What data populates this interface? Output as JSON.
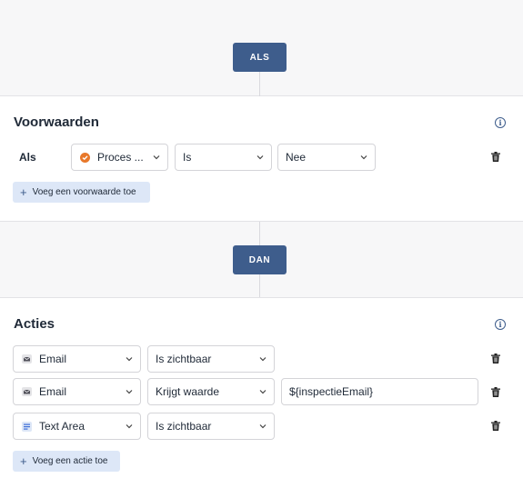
{
  "als_badge": "ALS",
  "dan_badge": "DAN",
  "conditions": {
    "title": "Voorwaarden",
    "row_label": "Als",
    "field": "Proces ...",
    "operator": "Is",
    "value": "Nee",
    "add_label": "Voeg een voorwaarde toe"
  },
  "actions": {
    "title": "Acties",
    "rows": [
      {
        "field": "Email",
        "field_icon": "email-icon",
        "action": "Is zichtbaar",
        "value": ""
      },
      {
        "field": "Email",
        "field_icon": "email-icon",
        "action": "Krijgt waarde",
        "value": "${inspectieEmail}"
      },
      {
        "field": "Text Area",
        "field_icon": "text-area-icon",
        "action": "Is zichtbaar",
        "value": ""
      }
    ],
    "add_label": "Voeg een actie toe"
  },
  "colors": {
    "accent": "#3e5d8c",
    "button_bg": "#dde7f7",
    "status_orange": "#e8782a"
  }
}
